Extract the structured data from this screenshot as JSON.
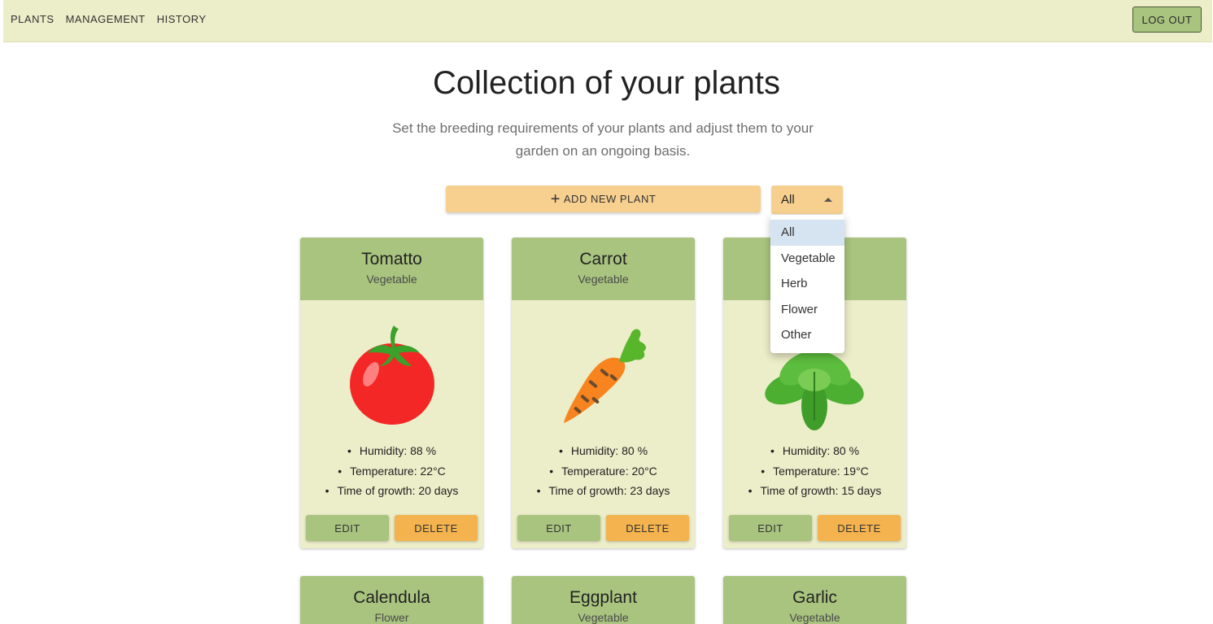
{
  "nav": {
    "items": [
      "PLANTS",
      "MANAGEMENT",
      "HISTORY"
    ],
    "logout_label": "LOG OUT"
  },
  "header": {
    "title": "Collection of your plants",
    "subtitle": "Set the breeding requirements of your plants and adjust them to your garden on an ongoing basis."
  },
  "toolbar": {
    "add_label": "ADD NEW PLANT",
    "add_icon": "plus-icon",
    "filter_value": "All",
    "filter_options": [
      "All",
      "Vegetable",
      "Herb",
      "Flower",
      "Other"
    ]
  },
  "cards": [
    {
      "name": "Tomatto",
      "type": "Vegetable",
      "icon": "tomato-icon",
      "humidity": "Humidity: 88 %",
      "temperature": "Temperature: 22°C",
      "growth": "Time of growth: 20 days",
      "edit": "EDIT",
      "delete": "DELETE"
    },
    {
      "name": "Carrot",
      "type": "Vegetable",
      "icon": "carrot-icon",
      "humidity": "Humidity: 80 %",
      "temperature": "Temperature: 20°C",
      "growth": "Time of growth: 23 days",
      "edit": "EDIT",
      "delete": "DELETE"
    },
    {
      "name": "",
      "type": "",
      "icon": "basil-icon",
      "humidity": "Humidity: 80 %",
      "temperature": "Temperature: 19°C",
      "growth": "Time of growth: 15 days",
      "edit": "EDIT",
      "delete": "DELETE"
    }
  ],
  "cards_row2": [
    {
      "name": "Calendula",
      "type": "Flower"
    },
    {
      "name": "Eggplant",
      "type": "Vegetable"
    },
    {
      "name": "Garlic",
      "type": "Vegetable"
    }
  ],
  "colors": {
    "navbar_bg": "#ecedc9",
    "card_header": "#a9c47f",
    "card_body": "#ecedc9",
    "accent_orange": "#f4b34e",
    "add_button": "#f7d08f",
    "selected_option": "#d6e4f2"
  }
}
